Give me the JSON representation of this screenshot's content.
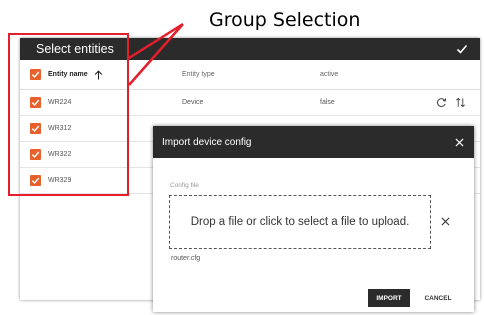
{
  "annotation": {
    "title": "Group Selection",
    "color": "#e41e2b"
  },
  "panel": {
    "title": "Select entities",
    "confirm_icon": "check-icon",
    "columns": {
      "name": "Entity name",
      "type": "Entity type",
      "active": "active"
    },
    "rows": [
      {
        "name": "WR224",
        "type": "Device",
        "active": "false",
        "checked": true
      },
      {
        "name": "WR312",
        "type": "",
        "active": "",
        "checked": true
      },
      {
        "name": "WR322",
        "type": "",
        "active": "",
        "checked": true
      },
      {
        "name": "WR329",
        "type": "",
        "active": "",
        "checked": true
      }
    ],
    "checkbox_color": "#e8612c"
  },
  "dialog": {
    "title": "Import device config",
    "field_label": "Config file",
    "dropzone_text": "Drop a file or click to select a file to upload.",
    "file_name": "router.cfg",
    "import_label": "IMPORT",
    "cancel_label": "CANCEL"
  },
  "colors": {
    "toolbar": "#2b2b2b",
    "accent": "#e8612c"
  }
}
